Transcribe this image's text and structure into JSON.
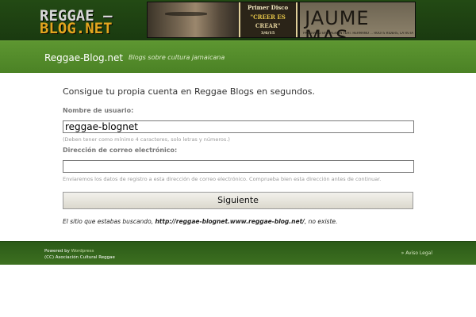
{
  "logo": {
    "line1": "REGGAE –",
    "line2": "BLOG.NET"
  },
  "banner": {
    "promo_line1": "Primer Disco",
    "promo_line2": "\"CREER ES",
    "promo_line3": "CREAR\"",
    "promo_date": "3/6/15",
    "artist": "JAUME MAS",
    "credits": "PRODUCED BY WAGWAN FEAT. HERMANO ... ROOTS RIDERS, LA RUTA ONENE"
  },
  "nav": {
    "site_title": "Reggae-Blog.net",
    "site_description": "Blogs sobre cultura jamaicana"
  },
  "signup": {
    "heading": "Consigue tu propia cuenta en Reggae Blogs en segundos.",
    "username_label": "Nombre de usuario:",
    "username_value": "reggae-blognet",
    "username_hint": "(Deben tener como mínimo 4 caracteres, solo letras y números.)",
    "email_label": "Dirección de correo electrónico:",
    "email_value": "",
    "email_hint": "Enviaremos los datos de registro a esta dirección de correo electrónico. Comprueba bien esta dirección antes de continuar.",
    "submit_label": "Siguiente",
    "not_exist_prefix": "El sitio que estabas buscando,",
    "not_exist_url": "http://reggae-blognet.www.reggae-blog.net/",
    "not_exist_suffix": ", no existe."
  },
  "footer": {
    "powered_prefix": "Powered by",
    "powered_link": "Wordpress",
    "copyright": "(CC) Asociación Cultural Reggae",
    "legal": "» Aviso Legal"
  },
  "colors": {
    "header_dark_green": "#234a14",
    "nav_green": "#5d9631",
    "footer_green": "#2b5a18",
    "logo_orange": "#e3a51f"
  }
}
